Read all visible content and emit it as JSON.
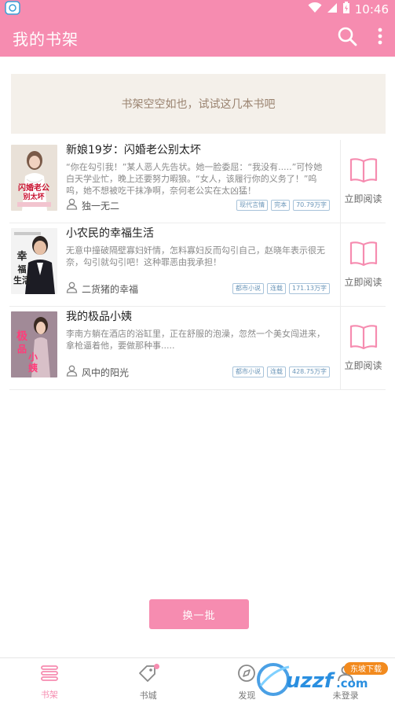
{
  "status_bar": {
    "time": "10:46"
  },
  "app_bar": {
    "title": "我的书架"
  },
  "empty_banner": {
    "text": "书架空空如也，试试这几本书吧"
  },
  "books": [
    {
      "title": "新娘19岁：闪婚老公别太坏",
      "description": "“你在勾引我！”某人恶人先告状。她一脸委屈：“我没有.....”可怜她白天学业忙，晚上还要努力暇狼。“女人，该履行你的义务了！”呜呜，她不想被吃干抹净啊，奈何老公实在太凶猛！",
      "author": "独一无二",
      "tags": [
        "现代言情",
        "完本",
        "70.79万字"
      ],
      "read_label": "立即阅读",
      "cover_text": "闪婚老公别太坏"
    },
    {
      "title": "小农民的幸福生活",
      "description": "无意中撞破隔壁寡妇奸情，怎料寡妇反而勾引自己，赵晓年表示很无奈，勾引就勾引吧！这种罪恶由我承担！",
      "author": "二货猪的幸福",
      "tags": [
        "都市小说",
        "连载",
        "171.13万字"
      ],
      "read_label": "立即阅读",
      "cover_text": "幸福生活"
    },
    {
      "title": "我的极品小姨",
      "description": "李南方躺在酒店的浴缸里，正在舒服的泡澡，忽然一个美女闯进来，拿枪逼着他，要做那种事.....",
      "author": "风中的阳光",
      "tags": [
        "都市小说",
        "连载",
        "428.75万字"
      ],
      "read_label": "立即阅读",
      "cover_text": "极品小姨"
    }
  ],
  "swap_button": {
    "label": "换一批"
  },
  "bottom_nav": [
    {
      "label": "书架",
      "active": true
    },
    {
      "label": "书城",
      "active": false
    },
    {
      "label": "发现",
      "active": false
    },
    {
      "label": "未登录",
      "active": false
    }
  ],
  "watermark": {
    "text": "uzzf.com",
    "badge": "东坡下载"
  },
  "colors": {
    "accent": "#f68cb0",
    "tag_blue": "#6a95b8",
    "banner_bg": "#f4f0ea"
  },
  "icons": [
    "app-icon",
    "wifi-icon",
    "signal-icon",
    "battery-icon",
    "search-icon",
    "more-vert-icon",
    "book-open-icon",
    "person-icon",
    "bookshelf-icon",
    "store-tag-icon",
    "discover-compass-icon",
    "user-icon"
  ]
}
